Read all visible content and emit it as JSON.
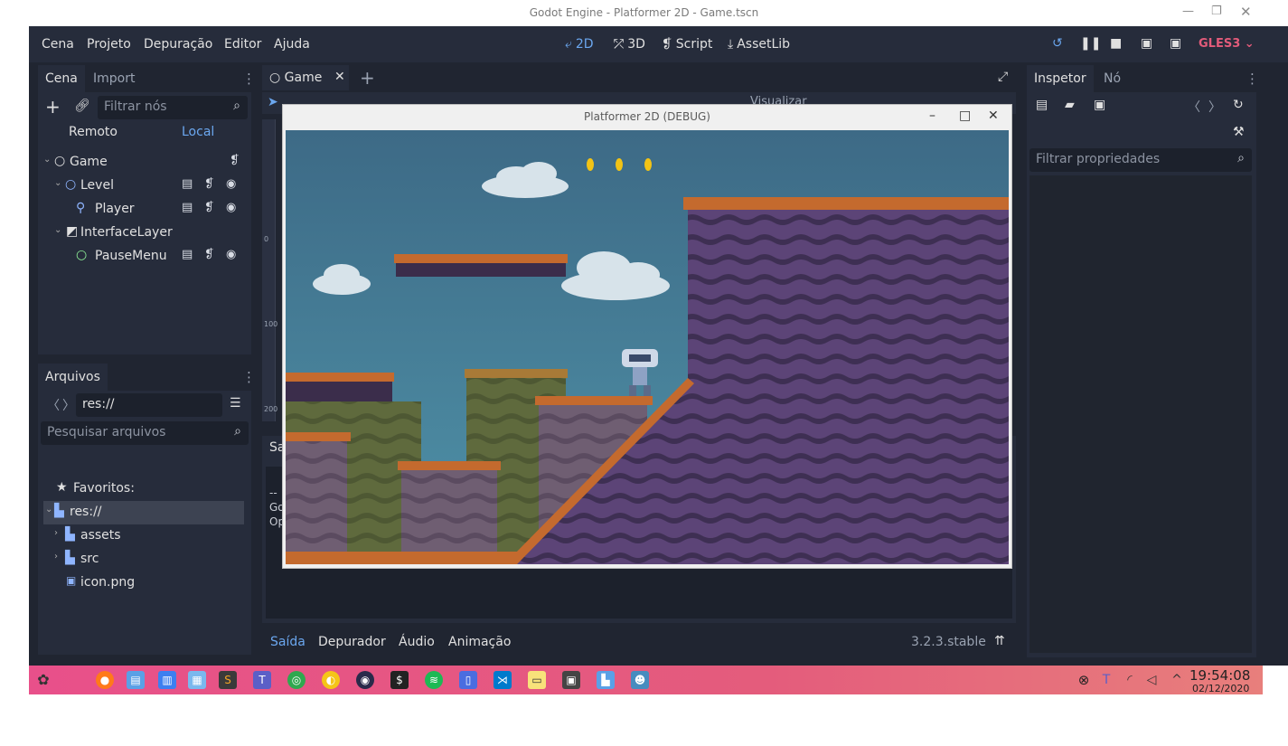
{
  "window": {
    "title": "Godot Engine - Platformer 2D - Game.tscn"
  },
  "menu": [
    "Cena",
    "Projeto",
    "Depuração",
    "Editor",
    "Ajuda"
  ],
  "workspaces": [
    {
      "label": "2D",
      "icon": "2d-icon"
    },
    {
      "label": "3D",
      "icon": "3d-icon"
    },
    {
      "label": "Script",
      "icon": "script-icon"
    },
    {
      "label": "AssetLib",
      "icon": "assetlib-icon"
    }
  ],
  "renderer": "GLES3",
  "scene_dock": {
    "tabs": [
      "Cena",
      "Import"
    ],
    "filter_placeholder": "Filtrar nós",
    "modes": [
      "Remoto",
      "Local"
    ],
    "tree": [
      {
        "label": "Game",
        "icon": "node-circle-icon"
      },
      {
        "label": "Level",
        "icon": "node-circle-icon"
      },
      {
        "label": "Player",
        "icon": "player-icon"
      },
      {
        "label": "InterfaceLayer",
        "icon": "canvas-layer-icon"
      },
      {
        "label": "PauseMenu",
        "icon": "control-node-icon"
      }
    ]
  },
  "files_dock": {
    "tab": "Arquivos",
    "path": "res://",
    "search_placeholder": "Pesquisar arquivos",
    "items": [
      {
        "label": "Favoritos:",
        "icon": "star-icon"
      },
      {
        "label": "res://",
        "icon": "folder-icon"
      },
      {
        "label": "assets",
        "icon": "folder-icon"
      },
      {
        "label": "src",
        "icon": "folder-icon"
      },
      {
        "label": "icon.png",
        "icon": "image-file-icon"
      }
    ]
  },
  "center": {
    "tab": "Game",
    "toolbar_view_label": "Visualizar",
    "ruler_labels": [
      "0",
      "100",
      "200"
    ],
    "output_tab_partial": "Sa",
    "output_lines": [
      "--",
      "Go",
      "Op"
    ],
    "bottom_tabs": [
      "Saída",
      "Depurador",
      "Áudio",
      "Animação"
    ],
    "version": "3.2.3.stable"
  },
  "inspector": {
    "tabs": [
      "Inspetor",
      "Nó"
    ],
    "filter_placeholder": "Filtrar propriedades"
  },
  "game_window": {
    "title": "Platformer 2D (DEBUG)",
    "coins_visible": 3
  },
  "taskbar": {
    "time": "19:54:08",
    "date": "02/12/2020"
  },
  "colors": {
    "editor_bg": "#202531",
    "panel_bg": "#262c3b",
    "accent": "#6ba7ef",
    "renderer": "#e35b7a",
    "taskbar": "#e8508a"
  }
}
